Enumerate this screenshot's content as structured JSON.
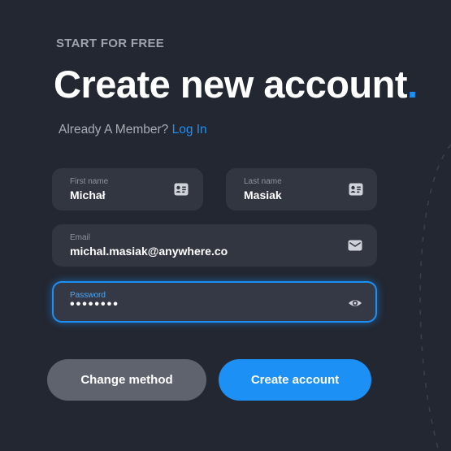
{
  "header": {
    "eyebrow": "START FOR FREE",
    "title": "Create new account",
    "title_dot": "."
  },
  "member": {
    "prompt": "Already A Member?",
    "link": "Log In"
  },
  "form": {
    "first_name": {
      "label": "First name",
      "value": "Michał",
      "icon": "id-card-icon"
    },
    "last_name": {
      "label": "Last name",
      "value": "Masiak",
      "icon": "id-card-icon"
    },
    "email": {
      "label": "Email",
      "value": "michal.masiak@anywhere.co",
      "icon": "envelope-icon"
    },
    "password": {
      "label": "Password",
      "value": "••••••••",
      "icon": "eye-icon",
      "focused": true
    }
  },
  "buttons": {
    "change_method": "Change method",
    "create_account": "Create account"
  },
  "colors": {
    "background": "#232731",
    "field": "#323641",
    "accent": "#1d90f5",
    "secondary_button": "#5f636e"
  }
}
